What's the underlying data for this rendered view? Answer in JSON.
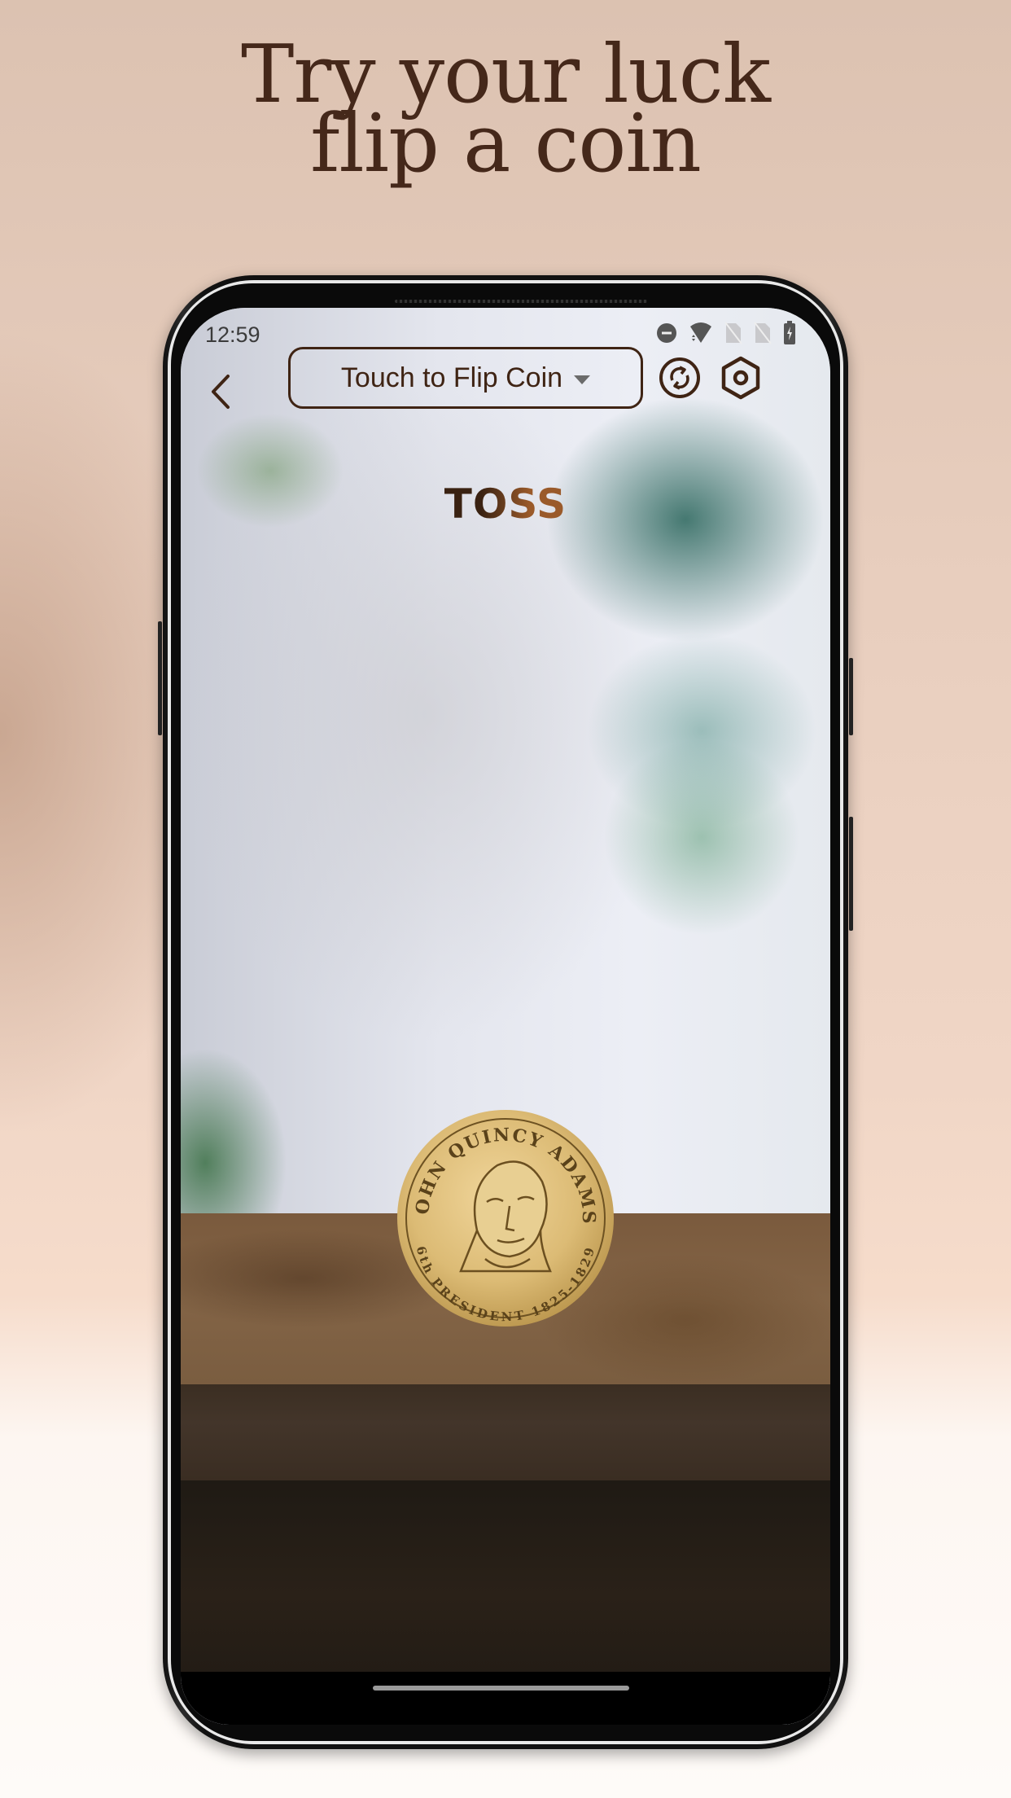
{
  "promo": {
    "headline_line1": "Try your luck",
    "headline_line2": "flip a coin"
  },
  "status_bar": {
    "time": "12:59",
    "icons": [
      "do-not-disturb-icon",
      "wifi-icon",
      "no-sim-icon",
      "no-sim-icon",
      "battery-charging-icon"
    ]
  },
  "toolbar": {
    "back_icon": "chevron-left-icon",
    "mode_dropdown": {
      "selected": "Touch to Flip Coin"
    },
    "reset_icon": "sync-circle-icon",
    "settings_icon": "settings-hexagon-icon"
  },
  "main": {
    "action_label": "TOSS",
    "coin": {
      "top_inscription": "JOHN QUINCY ADAMS",
      "bottom_inscription": "6th PRESIDENT 1825-1829"
    }
  },
  "colors": {
    "brand_brown": "#3f2414",
    "toss_gradient_start": "#3a2212",
    "toss_gradient_end": "#9a5a2a",
    "coin_gold": "#d8b66c"
  }
}
